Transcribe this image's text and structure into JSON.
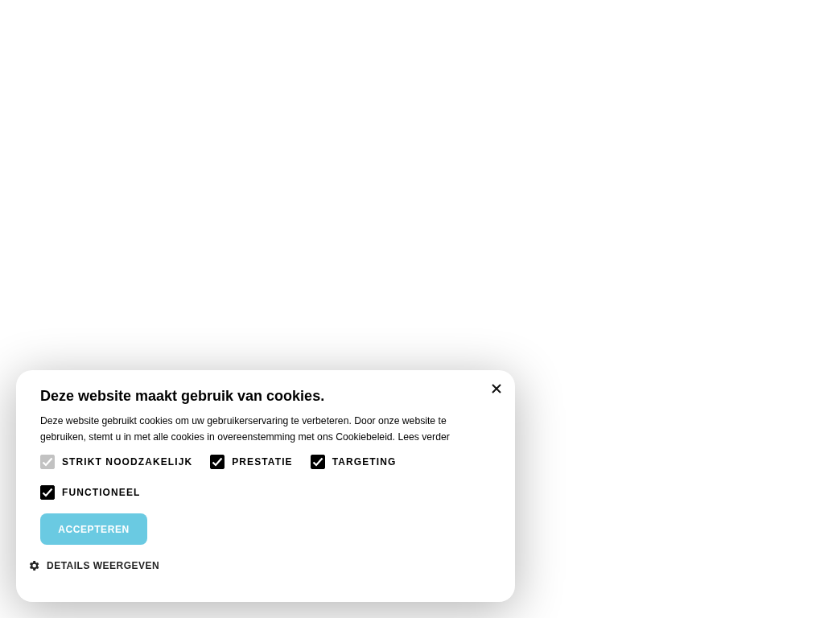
{
  "cookie_banner": {
    "title": "Deze website maakt gebruik van cookies.",
    "text": "Deze website gebruikt cookies om uw gebruikerservaring te verbeteren. Door onze website te gebruiken, stemt u in met alle cookies in overeenstemming met ons Cookiebeleid.",
    "link": "Lees verder",
    "options": [
      {
        "label": "STRIKT NOODZAKELIJK",
        "checked": true,
        "disabled": true
      },
      {
        "label": "PRESTATIE",
        "checked": true,
        "disabled": false
      },
      {
        "label": "TARGETING",
        "checked": true,
        "disabled": false
      },
      {
        "label": "FUNCTIONEEL",
        "checked": true,
        "disabled": false
      }
    ],
    "accept_button": "ACCEPTEREN",
    "details_link": "DETAILS WEERGEVEN"
  }
}
